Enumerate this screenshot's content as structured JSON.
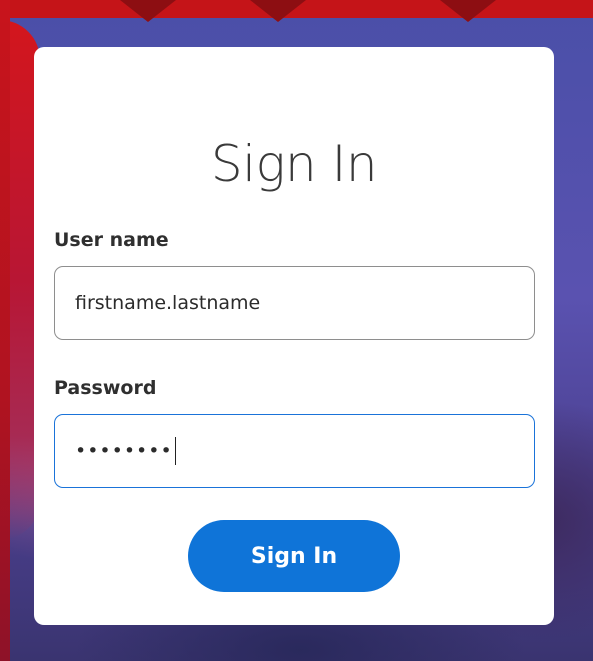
{
  "login": {
    "title": "Sign In",
    "username": {
      "label": "User name",
      "value": "firstname.lastname"
    },
    "password": {
      "label": "Password",
      "masked_value": "••••••••"
    },
    "submit_label": "Sign In"
  },
  "colors": {
    "accent": "#0f74d8",
    "focused_border": "#1a73d9",
    "card_background": "#ffffff",
    "background_purple": "#4a4fa8",
    "background_red": "#c51418"
  },
  "icons": []
}
